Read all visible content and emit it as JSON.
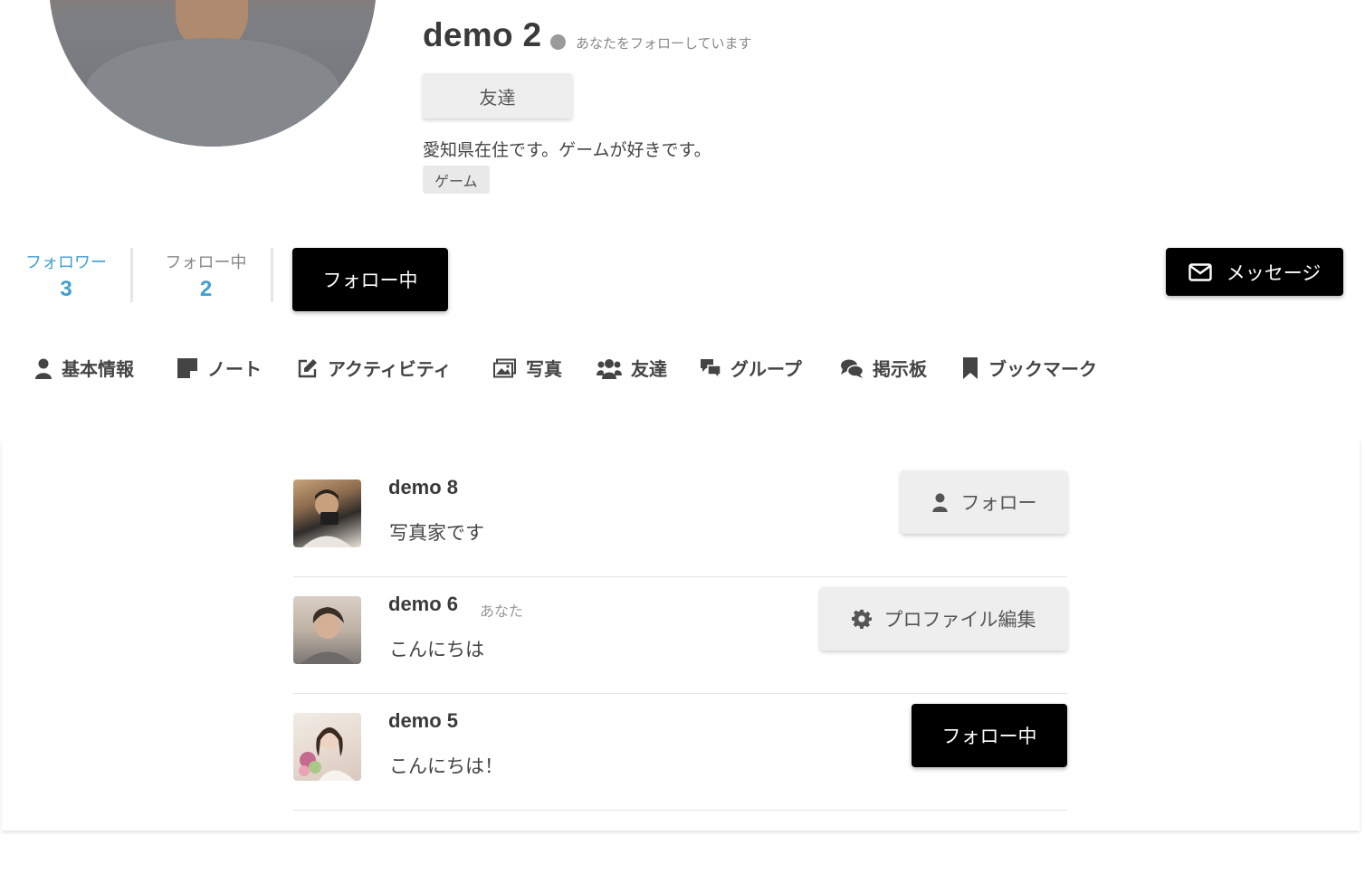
{
  "profile": {
    "name": "demo 2",
    "follow_status": "あなたをフォローしています",
    "relation_label": "友達",
    "bio": "愛知県在住です。ゲームが好きです。",
    "tags": [
      "ゲーム"
    ]
  },
  "stats": {
    "followers_label": "フォロワー",
    "followers_count": "3",
    "following_label": "フォロー中",
    "following_count": "2"
  },
  "actions": {
    "following_button": "フォロー中",
    "message_button": "メッセージ"
  },
  "colors": {
    "accent": "#3f9fd0",
    "primary_button": "#000000",
    "secondary_button": "#eeeeee"
  },
  "nav": [
    {
      "label": "基本情報",
      "icon": "user-icon"
    },
    {
      "label": "ノート",
      "icon": "note-icon"
    },
    {
      "label": "アクティビティ",
      "icon": "edit-icon"
    },
    {
      "label": "写真",
      "icon": "images-icon"
    },
    {
      "label": "友達",
      "icon": "users-icon"
    },
    {
      "label": "グループ",
      "icon": "comments-icon"
    },
    {
      "label": "掲示板",
      "icon": "forum-icon"
    },
    {
      "label": "ブックマーク",
      "icon": "bookmark-icon"
    }
  ],
  "users": [
    {
      "name": "demo 8",
      "description": "写真家です",
      "action": "フォロー",
      "action_icon": "user-icon"
    },
    {
      "name": "demo 6",
      "you_label": "あなた",
      "description": "こんにちは",
      "action": "プロファイル編集",
      "action_icon": "gear-icon"
    },
    {
      "name": "demo 5",
      "description": "こんにちは！",
      "action": "フォロー中"
    }
  ]
}
